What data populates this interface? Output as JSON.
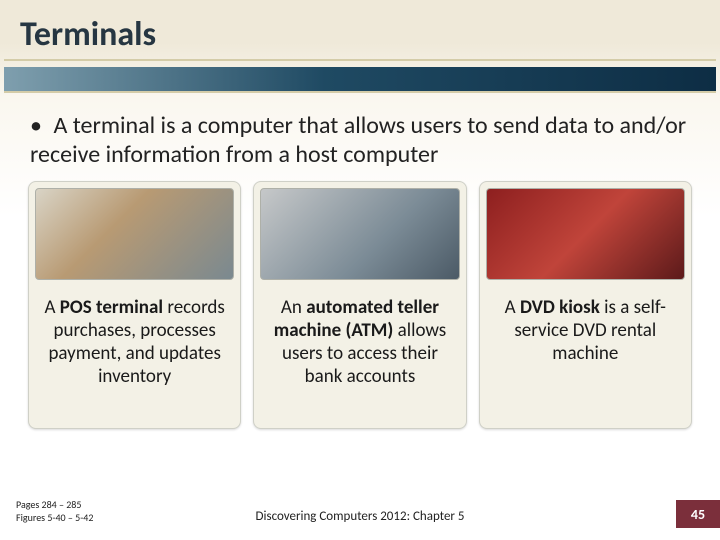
{
  "title": "Terminals",
  "bullet": "A terminal is a computer that allows users to send data to and/or receive information from a host computer",
  "cards": [
    {
      "image_name": "pos-terminal-photo",
      "caption_html": "A <b>POS terminal</b> records purchases, processes payment, and updates inventory"
    },
    {
      "image_name": "atm-photo",
      "caption_html": "An <b>automated teller machine (ATM)</b> allows users to access their bank accounts"
    },
    {
      "image_name": "dvd-kiosk-photo",
      "caption_html": "A <b>DVD kiosk</b> is a self-service DVD rental machine"
    }
  ],
  "footer": {
    "pages": "Pages 284 – 285",
    "figures": "Figures 5-40 – 5-42",
    "center": "Discovering Computers 2012: Chapter 5",
    "slide_number": "45"
  },
  "colors": {
    "accent_bar": "#0d2d44",
    "page_box": "#7b2f3b"
  }
}
